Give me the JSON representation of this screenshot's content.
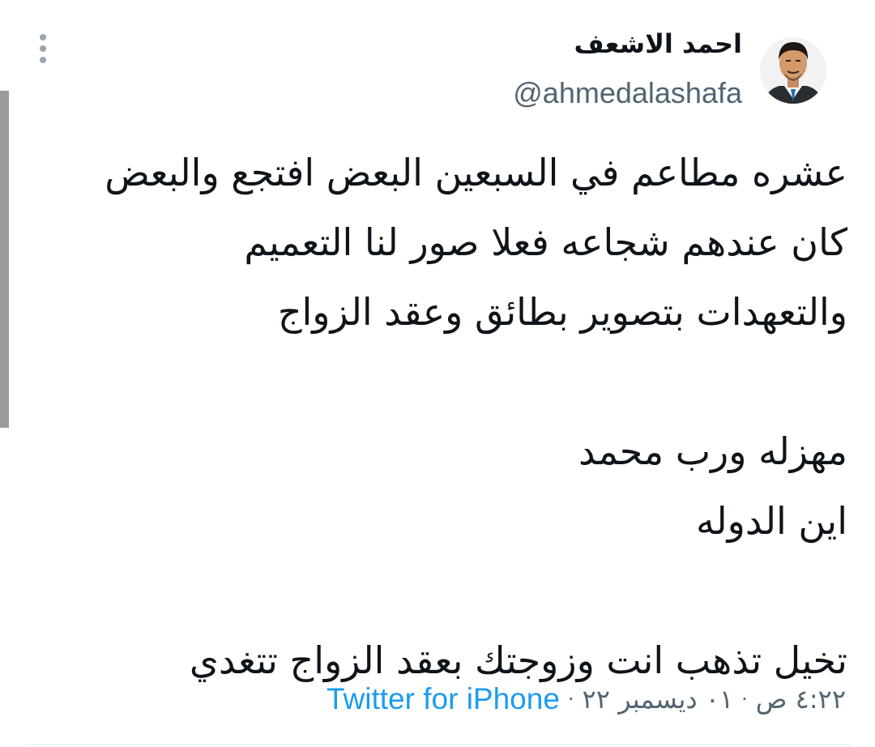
{
  "user": {
    "display_name": "احمد الاشعف",
    "handle": "@ahmedalashafa"
  },
  "tweet": {
    "lines": [
      "عشره مطاعم في السبعين البعض افتجع والبعض",
      "كان عندهم شجاعه فعلا صور لنا التعميم",
      "والتعهدات بتصوير بطائق وعقد الزواج",
      "",
      "مهزله ورب محمد",
      "اين الدوله",
      "",
      "تخيل تذهب انت وزوجتك بعقد الزواج تتغدي"
    ]
  },
  "meta": {
    "time": "٤:٢٢ ص",
    "separator_1": "·",
    "date": "٠١ ديسمبر ٢٢",
    "separator_2": "·",
    "source": "Twitter for iPhone"
  },
  "icons": {
    "more": "vertical-dots-icon",
    "avatar": "user-avatar"
  },
  "colors": {
    "text": "#0f1419",
    "secondary": "#536471",
    "link": "#1d9bf0"
  }
}
